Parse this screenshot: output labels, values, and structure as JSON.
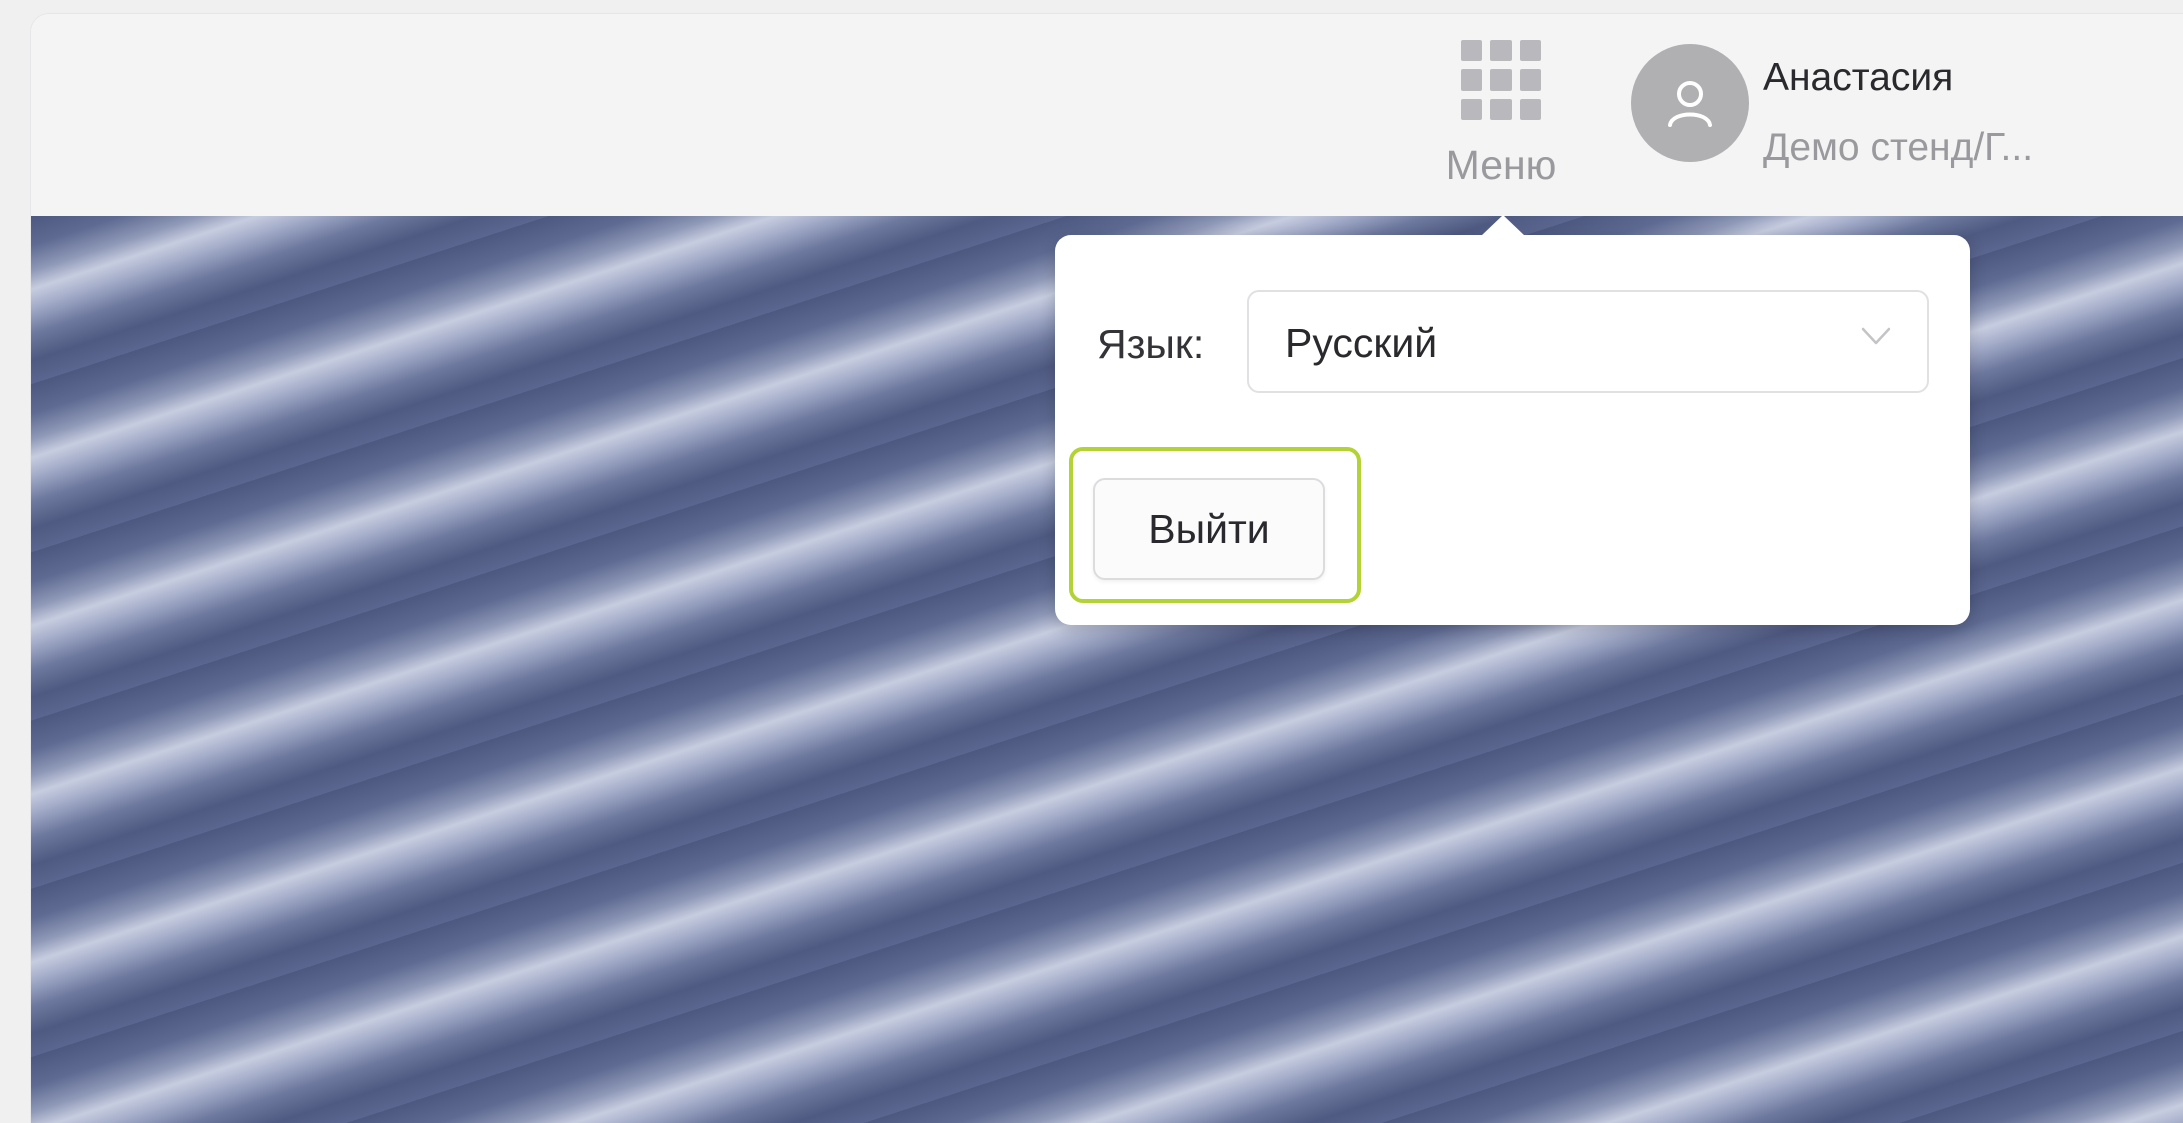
{
  "header": {
    "menu": {
      "label": "Меню",
      "icon": "grid-icon"
    },
    "user": {
      "name": "Анастасия",
      "organization": "Демо стенд/Г...",
      "icon": "user-avatar-icon"
    }
  },
  "popover": {
    "language": {
      "label": "Язык:",
      "selected": "Русский",
      "icon": "chevron-down-icon"
    },
    "logout_label": "Выйти",
    "highlight_color": "#b2d235"
  },
  "colors": {
    "header_bg": "#f4f4f4",
    "avatar_bg": "#b0b0b3",
    "accent": "#b2d235"
  }
}
